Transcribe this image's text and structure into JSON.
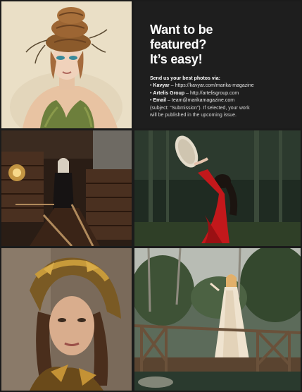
{
  "featured": {
    "headline": [
      "Want to be",
      "featured?",
      "It’s easy!"
    ],
    "intro": "Send us your best photos via:",
    "channels": [
      {
        "label": "Kavyar",
        "value": "https://kavyar.com/marika-magazine"
      },
      {
        "label": "Artelis Group",
        "value": "http://artelisgroup.com"
      },
      {
        "label": "Email",
        "value": "team@marikamagazine.com"
      }
    ],
    "note_lines": [
      "(subject: “Submission”). If selected, your work",
      "will be published in the upcoming issue."
    ],
    "bullet": "•",
    "separator": " – "
  },
  "photos": [
    {
      "subject": "woman with braided headpiece and moss top, cream backdrop"
    },
    {
      "subject": "woman standing on staircase in antique library"
    },
    {
      "subject": "woman in red dress holding frame drum in forest"
    },
    {
      "subject": "woman with golden leaves headwrap portrait"
    },
    {
      "subject": "woman in cream gown on wooden bridge in garden"
    }
  ]
}
